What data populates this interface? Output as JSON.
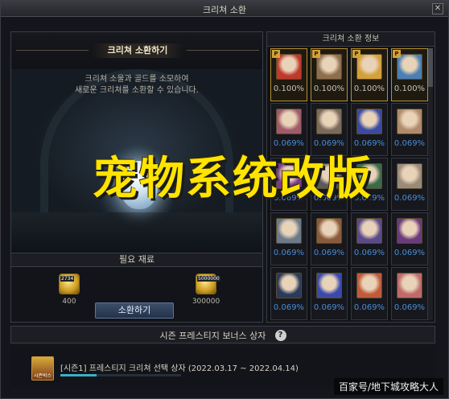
{
  "window": {
    "title": "크리쳐 소환",
    "close_glyph": "✕"
  },
  "left": {
    "title": "크리쳐 소환하기",
    "description_line1": "크리쳐 소울과 골드를 소모하여",
    "description_line2": "새로운 크리쳐를 소환할 수 있습니다.",
    "materials_header": "필요 재료",
    "materials": [
      {
        "icon": "soul-coin-icon",
        "badge": "2734",
        "count": "400"
      },
      {
        "icon": "gold-coins-icon",
        "badge": "5000000",
        "count": "300000"
      }
    ],
    "summon_button": "소환하기"
  },
  "right": {
    "header": "크리쳐 소환 정보",
    "premium_tag": "P",
    "cells": [
      {
        "rate": "0.100%",
        "premium": true,
        "color": "#c0392b"
      },
      {
        "rate": "0.100%",
        "premium": true,
        "color": "#8e6e4e"
      },
      {
        "rate": "0.100%",
        "premium": true,
        "color": "#d4a03a"
      },
      {
        "rate": "0.100%",
        "premium": true,
        "color": "#4a7fb5"
      },
      {
        "rate": "0.069%",
        "premium": false,
        "color": "#a05a6a"
      },
      {
        "rate": "0.069%",
        "premium": false,
        "color": "#7a6a5a"
      },
      {
        "rate": "0.069%",
        "premium": false,
        "color": "#3a4aa0"
      },
      {
        "rate": "0.069%",
        "premium": false,
        "color": "#b08a6a"
      },
      {
        "rate": "0.069%",
        "premium": false,
        "color": "#7a3a8a"
      },
      {
        "rate": "0.069%",
        "premium": false,
        "color": "#5a5a5a"
      },
      {
        "rate": "0.069%",
        "premium": false,
        "color": "#3a6a4a"
      },
      {
        "rate": "0.069%",
        "premium": false,
        "color": "#9a8a7a"
      },
      {
        "rate": "0.069%",
        "premium": false,
        "color": "#6a7a8a"
      },
      {
        "rate": "0.069%",
        "premium": false,
        "color": "#8a5a3a"
      },
      {
        "rate": "0.069%",
        "premium": false,
        "color": "#5a4a8a"
      },
      {
        "rate": "0.069%",
        "premium": false,
        "color": "#6a3a7a"
      },
      {
        "rate": "0.069%",
        "premium": false,
        "color": "#2a3a5a"
      },
      {
        "rate": "0.069%",
        "premium": false,
        "color": "#3a4aaa"
      },
      {
        "rate": "0.069%",
        "premium": false,
        "color": "#c05a3a"
      },
      {
        "rate": "0.069%",
        "premium": false,
        "color": "#c06a6a"
      }
    ]
  },
  "bonus": {
    "title": "시즌 프레스티지 보너스 상자",
    "help_glyph": "?",
    "item_icon_label": "시즌박스",
    "item_text": "[시즌1] 프레스티지 크리쳐 선택 상자 (2022.03.17 ~ 2022.04.14)",
    "progress_fraction": 0.3
  },
  "overlay": {
    "title": "宠物系统改版",
    "watermark": "百家号/地下城攻略大人"
  },
  "colors": {
    "accent_gold": "#ffe400",
    "rate_blue": "#4c8cd6",
    "premium_border": "#b58f2e"
  }
}
